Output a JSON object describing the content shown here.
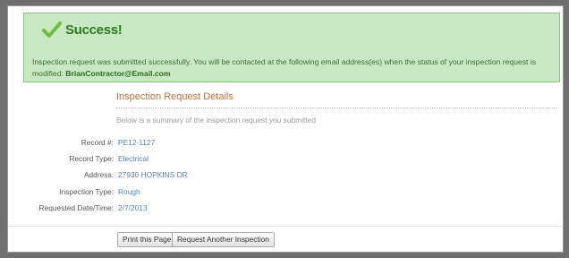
{
  "success": {
    "title": "Success!",
    "message_prefix": "Inspection request was submitted successfully. You will be contacted at the following email address(es) when the status of your inspection request is modified:",
    "email": "BrianContractor@Email.com",
    "icon": "checkmark-icon",
    "accent": "#2f7a22",
    "background": "#c8e8c3"
  },
  "details": {
    "title": "Inspection Request Details",
    "subtitle": "Below is a summary of the inspection request you submitted",
    "fields": [
      {
        "label": "Record #:",
        "value": "PE12-1127"
      },
      {
        "label": "Record Type:",
        "value": "Electrical"
      },
      {
        "label": "Address:",
        "value": "27930 HOPKINS DR"
      },
      {
        "label": "Inspection Type:",
        "value": "Rough"
      },
      {
        "label": "Requested Date/Time:",
        "value": "2/7/2013"
      }
    ]
  },
  "actions": {
    "print_label": "Print this Page",
    "request_label": "Request Another Inspection"
  }
}
